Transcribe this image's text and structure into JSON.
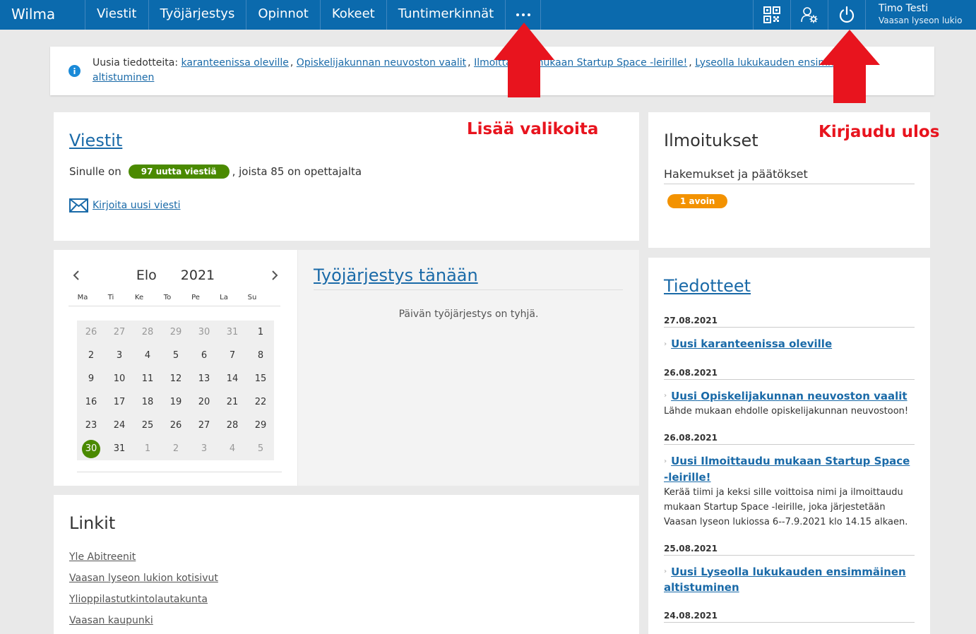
{
  "app": {
    "brand": "Wilma"
  },
  "nav": {
    "items": [
      {
        "label": "Viestit"
      },
      {
        "label": "Työjärjestys"
      },
      {
        "label": "Opinnot"
      },
      {
        "label": "Kokeet"
      },
      {
        "label": "Tuntimerkinnät"
      }
    ],
    "more_icon": "ellipsis-icon"
  },
  "user": {
    "name": "Timo Testi",
    "school": "Vaasan lyseon lukio"
  },
  "top_icons": [
    "qr-code-icon",
    "user-settings-icon",
    "power-icon"
  ],
  "infobar": {
    "prefix": "Uusia tiedotteita:",
    "links": [
      "karanteenissa oleville",
      "Opiskelijakunnan neuvoston vaalit",
      "Ilmoittaudu mukaan Startup Space -leirille!",
      "Lyseolla lukukauden ensimmäinen altistuminen"
    ],
    "separator": ","
  },
  "viestit": {
    "title": "Viestit",
    "prefix": "Sinulle on",
    "badge": "97 uutta viestiä",
    "suffix": ", joista 85 on opettajalta",
    "compose": "Kirjoita uusi viesti"
  },
  "calendar": {
    "month": "Elo",
    "year": "2021",
    "weekdays": [
      "Ma",
      "Ti",
      "Ke",
      "To",
      "Pe",
      "La",
      "Su"
    ],
    "days": [
      {
        "d": "26",
        "other": true
      },
      {
        "d": "27",
        "other": true
      },
      {
        "d": "28",
        "other": true
      },
      {
        "d": "29",
        "other": true
      },
      {
        "d": "30",
        "other": true
      },
      {
        "d": "31",
        "other": true
      },
      {
        "d": "1"
      },
      {
        "d": "2"
      },
      {
        "d": "3"
      },
      {
        "d": "4"
      },
      {
        "d": "5"
      },
      {
        "d": "6"
      },
      {
        "d": "7"
      },
      {
        "d": "8"
      },
      {
        "d": "9"
      },
      {
        "d": "10"
      },
      {
        "d": "11"
      },
      {
        "d": "12"
      },
      {
        "d": "13"
      },
      {
        "d": "14"
      },
      {
        "d": "15"
      },
      {
        "d": "16"
      },
      {
        "d": "17"
      },
      {
        "d": "18"
      },
      {
        "d": "19"
      },
      {
        "d": "20"
      },
      {
        "d": "21"
      },
      {
        "d": "22"
      },
      {
        "d": "23"
      },
      {
        "d": "24"
      },
      {
        "d": "25"
      },
      {
        "d": "26"
      },
      {
        "d": "27"
      },
      {
        "d": "28"
      },
      {
        "d": "29"
      },
      {
        "d": "30",
        "today": true
      },
      {
        "d": "31"
      },
      {
        "d": "1",
        "other": true
      },
      {
        "d": "2",
        "other": true
      },
      {
        "d": "3",
        "other": true
      },
      {
        "d": "4",
        "other": true
      },
      {
        "d": "5",
        "other": true
      }
    ]
  },
  "schedule": {
    "title": "Työjärjestys tänään",
    "empty": "Päivän työjärjestys on tyhjä."
  },
  "linkit": {
    "title": "Linkit",
    "links": [
      "Yle Abitreenit",
      "Vaasan lyseon lukion kotisivut",
      "Ylioppilastutkintolautakunta",
      "Vaasan kaupunki"
    ]
  },
  "ilmoitukset": {
    "title": "Ilmoitukset",
    "sub": "Hakemukset ja päätökset",
    "badge": "1 avoin"
  },
  "tiedotteet": {
    "title": "Tiedotteet",
    "new_label": "Uusi",
    "items": [
      {
        "date": "27.08.2021",
        "title": "karanteenissa oleville",
        "desc": ""
      },
      {
        "date": "26.08.2021",
        "title": "Opiskelijakunnan neuvoston vaalit",
        "desc": "Lähde mukaan ehdolle opiskelijakunnan neuvostoon!"
      },
      {
        "date": "26.08.2021",
        "title": "Ilmoittaudu mukaan Startup Space -leirille!",
        "desc": "Kerää tiimi ja keksi sille voittoisa nimi ja ilmoittaudu mukaan Startup Space -leirille, joka järjestetään Vaasan lyseon lukiossa 6--7.9.2021 klo 14.15 alkaen."
      },
      {
        "date": "25.08.2021",
        "title": "Lyseolla lukukauden ensimmäinen altistuminen",
        "desc": ""
      },
      {
        "date": "24.08.2021",
        "title": "",
        "desc": ""
      }
    ]
  },
  "annotations": {
    "more_menus": "Lisää valikoita",
    "logout": "Kirjaudu ulos"
  },
  "colors": {
    "nav_bg": "#0b6aad",
    "badge_green": "#4a8a00",
    "badge_orange": "#f39200",
    "annotation_red": "#e8141e"
  }
}
